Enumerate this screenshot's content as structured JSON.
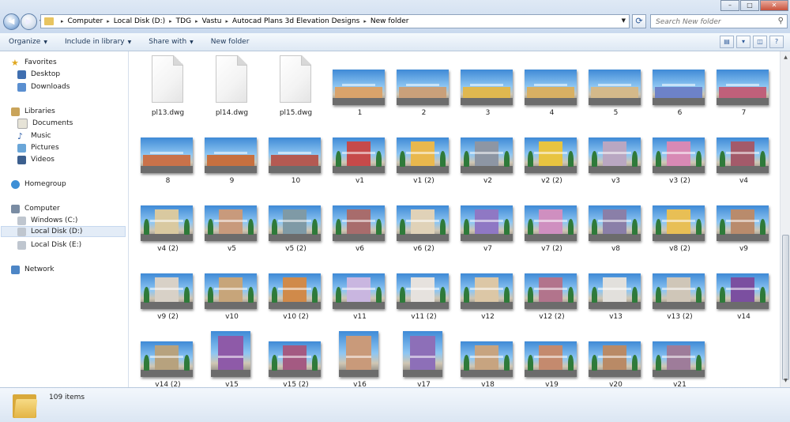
{
  "window": {
    "min_icon": "minimize-icon",
    "max_icon": "maximize-icon",
    "close_icon": "close-icon"
  },
  "address": {
    "crumbs": [
      "Computer",
      "Local Disk (D:)",
      "TDG",
      "Vastu",
      "Autocad Plans 3d Elevation Designs",
      "New folder"
    ]
  },
  "search": {
    "placeholder": "Search New folder"
  },
  "toolbar": {
    "organize": "Organize",
    "include": "Include in library",
    "share": "Share with",
    "new_folder": "New folder"
  },
  "sidebar": {
    "favorites": "Favorites",
    "desktop": "Desktop",
    "downloads": "Downloads",
    "libraries": "Libraries",
    "documents": "Documents",
    "music": "Music",
    "pictures": "Pictures",
    "videos": "Videos",
    "homegroup": "Homegroup",
    "computer": "Computer",
    "drive_c": "Windows (C:)",
    "drive_d": "Local Disk (D:)",
    "drive_e": "Local Disk (E:)",
    "network": "Network"
  },
  "files": [
    {
      "name": "pl13.dwg",
      "kind": "dwg"
    },
    {
      "name": "pl14.dwg",
      "kind": "dwg"
    },
    {
      "name": "pl15.dwg",
      "kind": "dwg"
    },
    {
      "name": "1",
      "kind": "wide",
      "color": "#d9a36b"
    },
    {
      "name": "2",
      "kind": "wide",
      "color": "#c9a07a"
    },
    {
      "name": "3",
      "kind": "wide",
      "color": "#e0b84f"
    },
    {
      "name": "4",
      "kind": "wide",
      "color": "#d8b063"
    },
    {
      "name": "5",
      "kind": "wide",
      "color": "#d4b98a"
    },
    {
      "name": "6",
      "kind": "wide",
      "color": "#6d82c8"
    },
    {
      "name": "7",
      "kind": "wide",
      "color": "#c0607a"
    },
    {
      "name": "8",
      "kind": "wide",
      "color": "#c9724a"
    },
    {
      "name": "9",
      "kind": "wide",
      "color": "#c7703f"
    },
    {
      "name": "10",
      "kind": "wide",
      "color": "#b45a52"
    },
    {
      "name": "v1",
      "kind": "house",
      "color": "#c64a4a"
    },
    {
      "name": "v1 (2)",
      "kind": "house",
      "color": "#e9b84d"
    },
    {
      "name": "v2",
      "kind": "house",
      "color": "#8d96a4"
    },
    {
      "name": "v2 (2)",
      "kind": "house",
      "color": "#e8c440"
    },
    {
      "name": "v3",
      "kind": "house",
      "color": "#b9a7c2"
    },
    {
      "name": "v3 (2)",
      "kind": "house",
      "color": "#d889b5"
    },
    {
      "name": "v4",
      "kind": "house",
      "color": "#a35a6a"
    },
    {
      "name": "v4 (2)",
      "kind": "house",
      "color": "#d9c9a0"
    },
    {
      "name": "v5",
      "kind": "house",
      "color": "#c89a7c"
    },
    {
      "name": "v5 (2)",
      "kind": "house",
      "color": "#7f9aa6"
    },
    {
      "name": "v6",
      "kind": "house",
      "color": "#a86c6c"
    },
    {
      "name": "v6 (2)",
      "kind": "house",
      "color": "#e0d2b8"
    },
    {
      "name": "v7",
      "kind": "house",
      "color": "#8f78c4"
    },
    {
      "name": "v7 (2)",
      "kind": "house",
      "color": "#cf8fc0"
    },
    {
      "name": "v8",
      "kind": "house",
      "color": "#8a7fa8"
    },
    {
      "name": "v8 (2)",
      "kind": "house",
      "color": "#e8bf55"
    },
    {
      "name": "v9",
      "kind": "house",
      "color": "#b98b6c"
    },
    {
      "name": "v9 (2)",
      "kind": "house",
      "color": "#d8d1c7"
    },
    {
      "name": "v10",
      "kind": "house",
      "color": "#c7a57a"
    },
    {
      "name": "v10 (2)",
      "kind": "house",
      "color": "#d08a4a"
    },
    {
      "name": "v11",
      "kind": "house",
      "color": "#c9b6e0"
    },
    {
      "name": "v11 (2)",
      "kind": "house",
      "color": "#e6e2de"
    },
    {
      "name": "v12",
      "kind": "house",
      "color": "#dcc7a6"
    },
    {
      "name": "v12 (2)",
      "kind": "house",
      "color": "#b2748c"
    },
    {
      "name": "v13",
      "kind": "house",
      "color": "#e2e0dc"
    },
    {
      "name": "v13 (2)",
      "kind": "house",
      "color": "#cfc6b8"
    },
    {
      "name": "v14",
      "kind": "house",
      "color": "#7b4fa0"
    },
    {
      "name": "v14 (2)",
      "kind": "house",
      "color": "#b7a27e"
    },
    {
      "name": "v15",
      "kind": "tall",
      "color": "#8e5aa8"
    },
    {
      "name": "v15 (2)",
      "kind": "house",
      "color": "#a45a82"
    },
    {
      "name": "v16",
      "kind": "tall",
      "color": "#c99a7a"
    },
    {
      "name": "v17",
      "kind": "tall",
      "color": "#8d6fb8"
    },
    {
      "name": "v18",
      "kind": "house",
      "color": "#c7a480"
    },
    {
      "name": "v19",
      "kind": "house",
      "color": "#c48a6e"
    },
    {
      "name": "v20",
      "kind": "house",
      "color": "#b98a66"
    },
    {
      "name": "v21",
      "kind": "house",
      "color": "#9e7c9a"
    }
  ],
  "status": {
    "count": "109 items"
  }
}
